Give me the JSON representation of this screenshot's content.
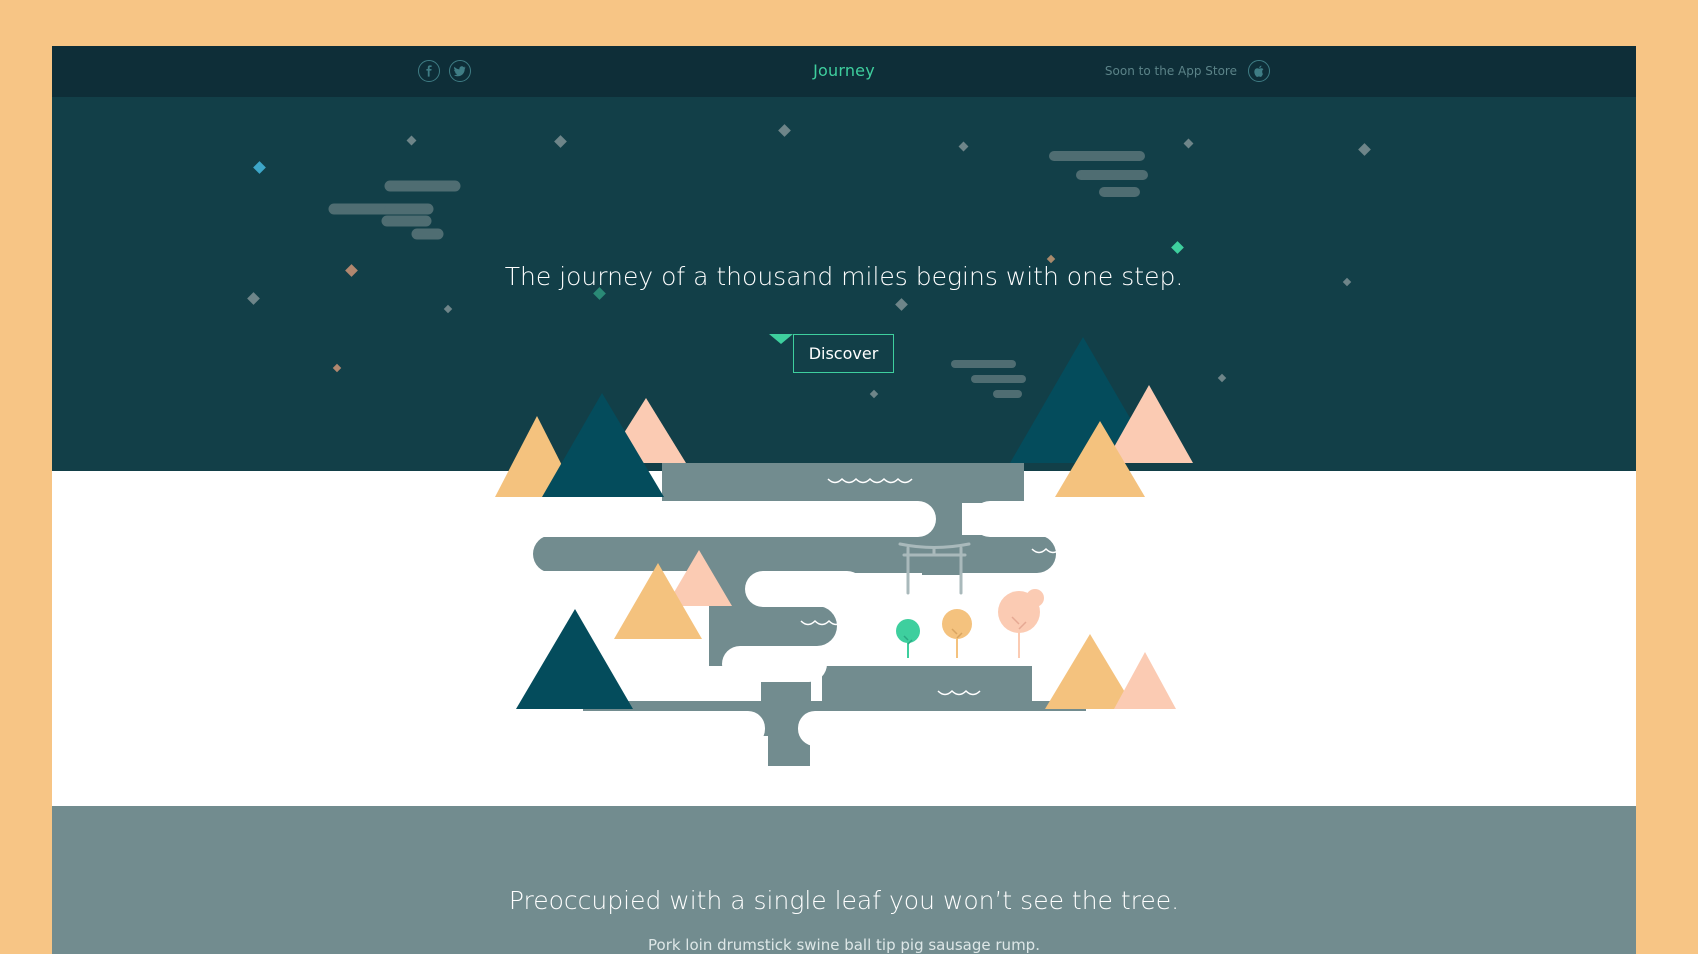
{
  "nav": {
    "brand": "Journey",
    "appstore_label": "Soon to the App Store",
    "social_icons": [
      "facebook-icon",
      "twitter-icon"
    ],
    "appstore_icon": "apple-icon"
  },
  "hero": {
    "headline": "The journey of a thousand miles begins with one step.",
    "cta_label": "Discover",
    "scroll_icon": "triangle-down-icon"
  },
  "section": {
    "headline": "Preoccupied with a single leaf you won’t see the tree.",
    "body": "Pork loin drumstick swine ball tip pig sausage rump."
  },
  "colors": {
    "page_background": "#f7c585",
    "nav_background": "#0e2e38",
    "hero_background": "#123f48",
    "accent": "#3ecf9e",
    "river": "#728c8f",
    "mountain_dark": "#044c5c",
    "mountain_peach": "#fbcbb3",
    "mountain_sand": "#f4c27e"
  }
}
